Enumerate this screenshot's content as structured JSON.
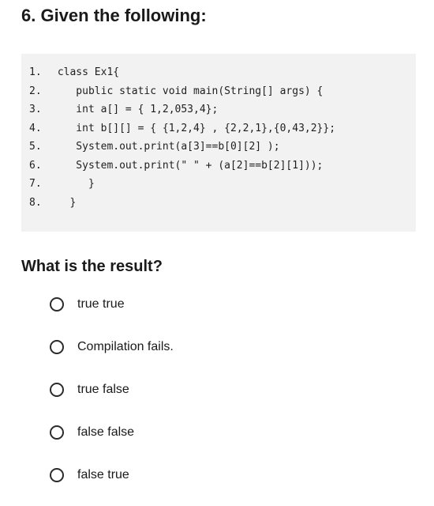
{
  "question": {
    "title": "6. Given the following:"
  },
  "code": {
    "lines": [
      {
        "number": "1.",
        "text": " class Ex1{"
      },
      {
        "number": "2.",
        "text": "    public static void main(String[] args) {"
      },
      {
        "number": "3.",
        "text": "    int a[] = { 1,2,053,4};"
      },
      {
        "number": "4.",
        "text": "    int b[][] = { {1,2,4} , {2,2,1},{0,43,2}};"
      },
      {
        "number": "5.",
        "text": "    System.out.print(a[3]==b[0][2] );"
      },
      {
        "number": "6.",
        "text": "    System.out.print(\" \" + (a[2]==b[2][1]));"
      },
      {
        "number": "7.",
        "text": "      }"
      },
      {
        "number": "8.",
        "text": "   }"
      }
    ]
  },
  "prompt": "What is the result?",
  "options": [
    {
      "label": "true true"
    },
    {
      "label": "Compilation fails."
    },
    {
      "label": "true false"
    },
    {
      "label": "false false"
    },
    {
      "label": "false true"
    }
  ]
}
